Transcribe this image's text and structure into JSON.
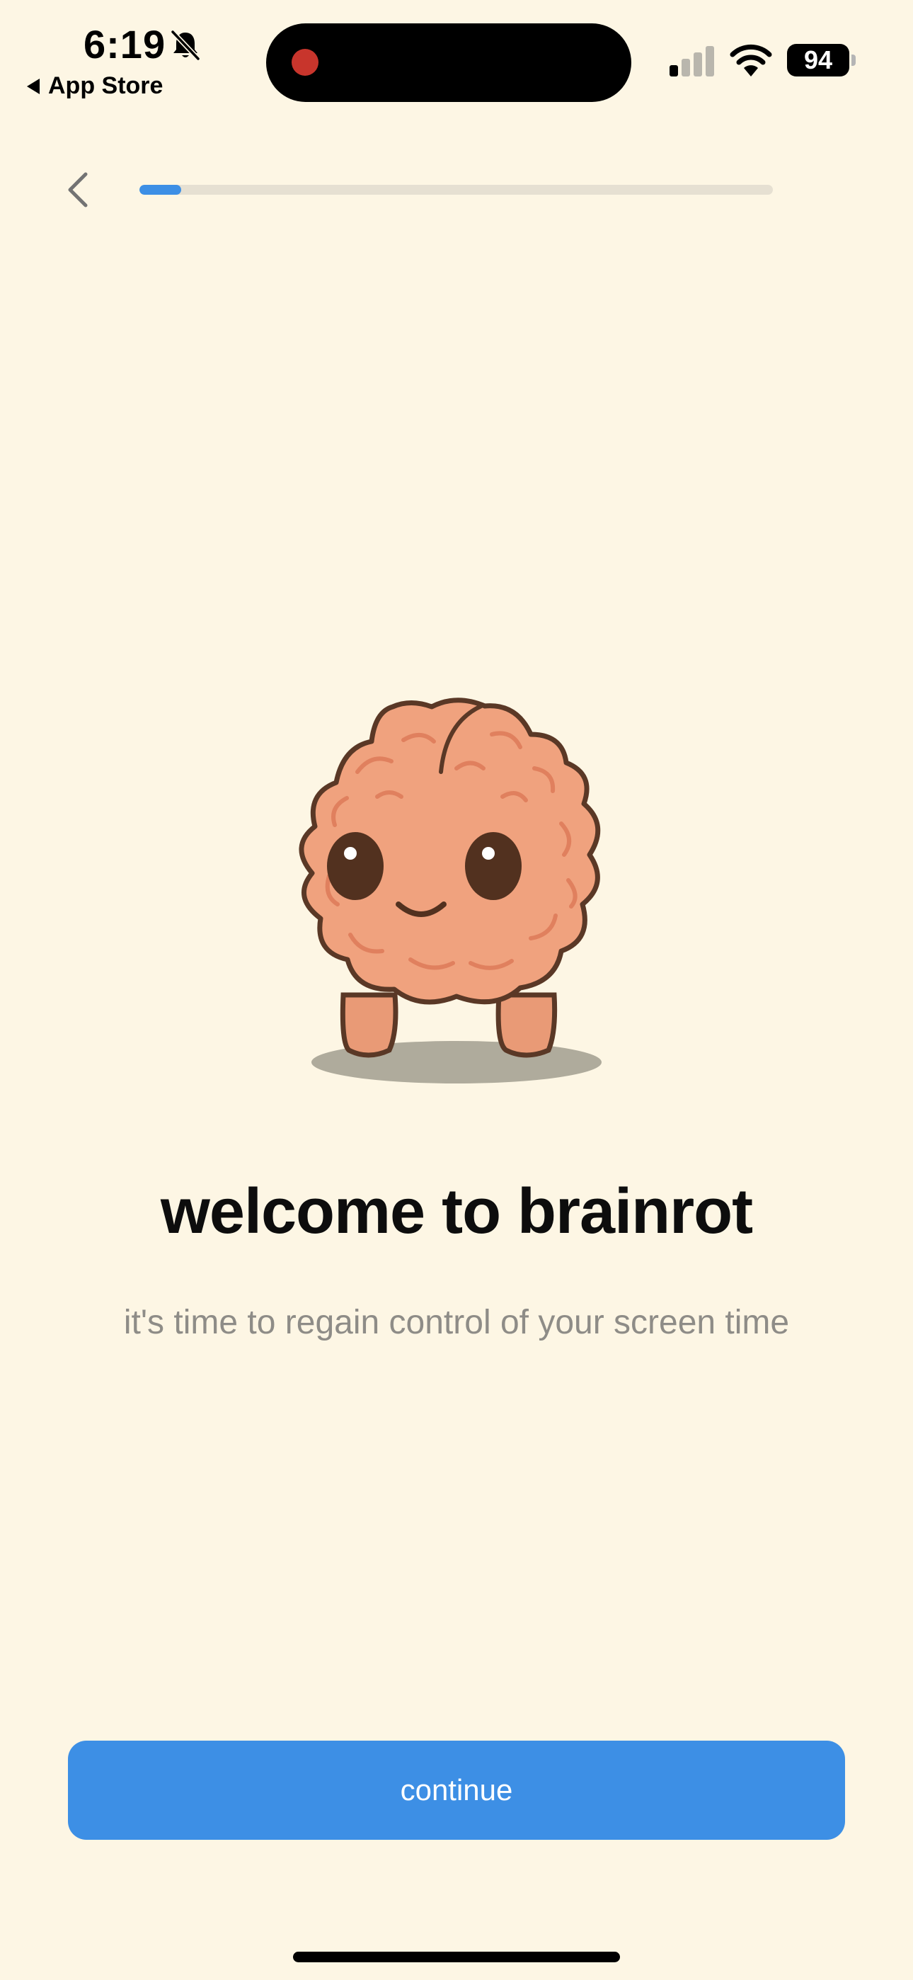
{
  "status_bar": {
    "time": "6:19",
    "back_to_app": "App Store",
    "battery": "94",
    "signal_bars_active": 1,
    "signal_bars_total": 4
  },
  "onboarding": {
    "progress": 0.066,
    "headline": "welcome to brainrot",
    "subtitle": "it's time to regain control of your screen time",
    "continue_label": "continue"
  },
  "icons": {
    "back": "chevron-left-icon",
    "mascot": "brain-mascot-illustration",
    "bell": "bell-slash-icon",
    "signal": "cellular-signal-icon",
    "wifi": "wifi-icon"
  },
  "colors": {
    "background": "#fdf6e4",
    "accent": "#3d8fe5",
    "progress_track": "#e6e0d2",
    "brain": "#f0a27e",
    "outline": "#5a3826"
  }
}
